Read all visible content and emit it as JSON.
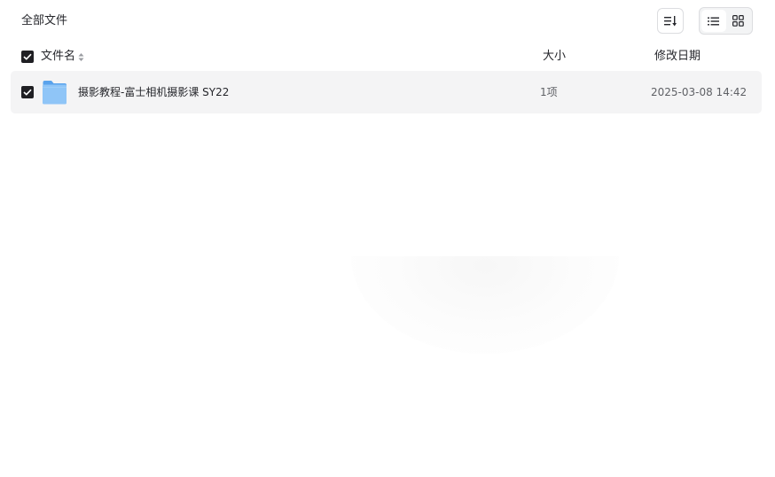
{
  "breadcrumb": {
    "label": "全部文件"
  },
  "toolbar": {
    "sort_icon": "sort-icon",
    "view_list_icon": "list-view-icon",
    "view_grid_icon": "grid-view-icon",
    "active_view": "list"
  },
  "table": {
    "columns": {
      "name": "文件名",
      "size": "大小",
      "modified": "修改日期"
    },
    "header_checked": true,
    "rows": [
      {
        "name": "摄影教程-富士相机摄影课 SY22",
        "size": "1项",
        "modified": "2025-03-08 14:42",
        "type_icon": "folder-icon",
        "checked": true
      }
    ]
  },
  "colors": {
    "text": "#25262b",
    "muted": "#5f6166",
    "checkbox": "#1f1f23",
    "row_highlight": "#f4f4f5",
    "folder": "#7ab8f5",
    "border": "#dcdde0"
  }
}
